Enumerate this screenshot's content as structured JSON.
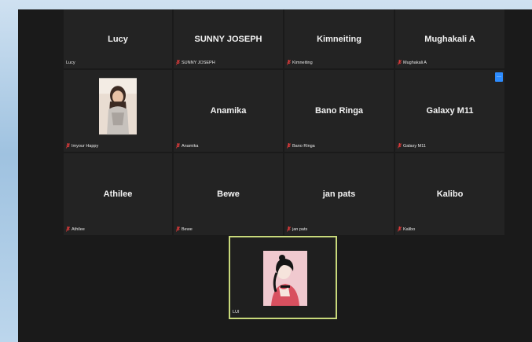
{
  "colors": {
    "selfview_border": "#c8d97b",
    "mute": "#e23b3b",
    "accent": "#2d8cff"
  },
  "participants": [
    {
      "name": "Lucy",
      "label": "Lucy",
      "muted": false
    },
    {
      "name": "SUNNY JOSEPH",
      "label": "SUNNY JOSEPH",
      "muted": true
    },
    {
      "name": "Kimneiting",
      "label": "Kimneiting",
      "muted": true
    },
    {
      "name": "Mughakali A",
      "label": "Mughakali A",
      "muted": true
    },
    {
      "name": "",
      "label": "Imyour Happy",
      "muted": true,
      "has_video": true
    },
    {
      "name": "Anamika",
      "label": "Anamika",
      "muted": true
    },
    {
      "name": "Bano Ringa",
      "label": "Bano Ringa",
      "muted": true
    },
    {
      "name": "Galaxy M11",
      "label": "Galaxy M11",
      "muted": true,
      "menu_icon": "more-icon"
    },
    {
      "name": "Athilee",
      "label": "Athilee",
      "muted": true
    },
    {
      "name": "Bewe",
      "label": "Bewe",
      "muted": true
    },
    {
      "name": "jan pats",
      "label": "jan pats",
      "muted": true
    },
    {
      "name": "Kalibo",
      "label": "Kalibo",
      "muted": true
    }
  ],
  "self_view": {
    "label": "LUI"
  }
}
